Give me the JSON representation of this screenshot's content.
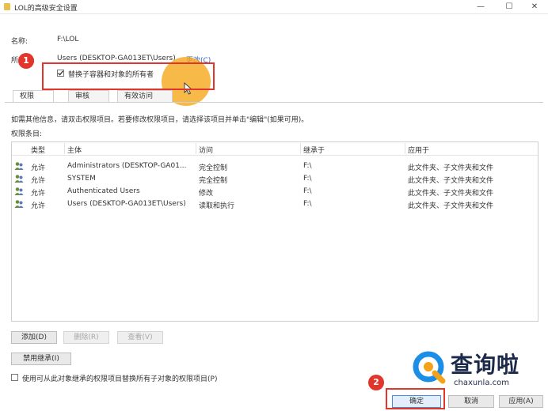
{
  "window": {
    "title": "LOL的高级安全设置",
    "minimize": "—",
    "maximize": "☐",
    "close": "✕"
  },
  "info": {
    "name_label": "名称:",
    "name_value": "F:\\LOL",
    "owner_label": "所有者:",
    "owner_value": "Users (DESKTOP-GA013ET\\Users)",
    "change_link": "更改(C)",
    "replace_owner_checkbox": "替换子容器和对象的所有者",
    "replace_owner_checked": true
  },
  "tabs": [
    "权限",
    "审核",
    "有效访问"
  ],
  "instruction": "如需其他信息，请双击权限项目。若要修改权限项目，请选择该项目并单击\"编辑\"(如果可用)。",
  "entries_label": "权限条目:",
  "table": {
    "columns": [
      "类型",
      "主体",
      "访问",
      "继承于",
      "应用于"
    ],
    "rows": [
      {
        "type": "允许",
        "principal": "Administrators (DESKTOP-GA01...",
        "access": "完全控制",
        "inherited": "F:\\",
        "applies": "此文件夹、子文件夹和文件"
      },
      {
        "type": "允许",
        "principal": "SYSTEM",
        "access": "完全控制",
        "inherited": "F:\\",
        "applies": "此文件夹、子文件夹和文件"
      },
      {
        "type": "允许",
        "principal": "Authenticated Users",
        "access": "修改",
        "inherited": "F:\\",
        "applies": "此文件夹、子文件夹和文件"
      },
      {
        "type": "允许",
        "principal": "Users (DESKTOP-GA013ET\\Users)",
        "access": "读取和执行",
        "inherited": "F:\\",
        "applies": "此文件夹、子文件夹和文件"
      }
    ]
  },
  "buttons": {
    "add": "添加(D)",
    "remove": "删除(R)",
    "view": "查看(V)",
    "disable_inheritance": "禁用继承(I)",
    "ok": "确定",
    "cancel": "取消",
    "apply": "应用(A)"
  },
  "replace_child_permissions": "使用可从此对象继承的权限项目替换所有子对象的权限项目(P)",
  "replace_child_checked": false,
  "annotations": {
    "step1": "1",
    "step2": "2"
  },
  "watermark": {
    "text": "查询啦",
    "url": "chaxunla.com"
  },
  "colors": {
    "highlight_red": "#e2352b",
    "cursor_orange": "#f5aa1e",
    "link_blue": "#3366cc"
  }
}
